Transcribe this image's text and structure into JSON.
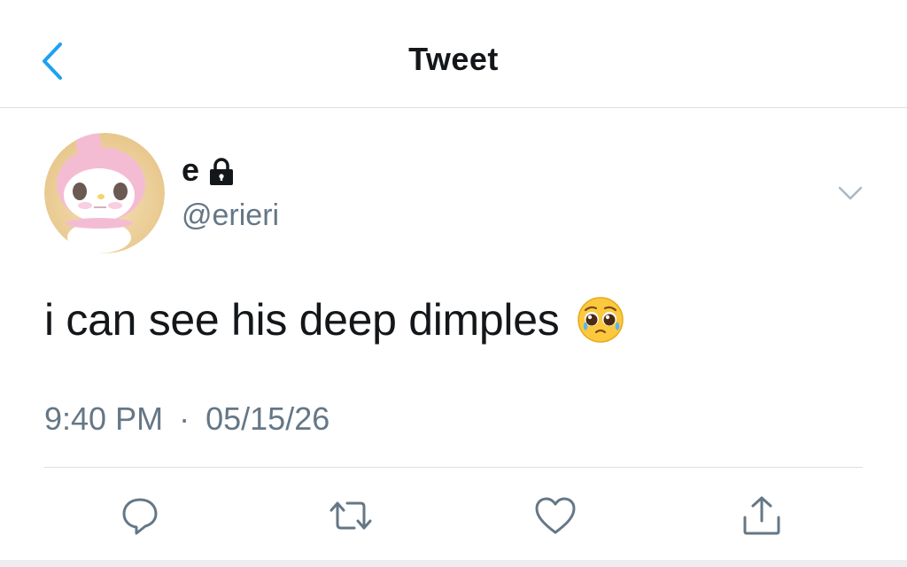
{
  "header": {
    "title": "Tweet",
    "back_icon": "chevron-left-icon"
  },
  "author": {
    "display_name": "e",
    "protected_icon": "lock-icon",
    "username": "@erieri",
    "avatar": "pink-bunny-hood-character"
  },
  "tweet": {
    "text": "i can see his deep dimples",
    "emoji": "pleading-face-with-tears",
    "time": "9:40 PM",
    "separator": "·",
    "date": "05/15/26"
  },
  "actions": [
    {
      "name": "reply",
      "icon": "speech-bubble-icon"
    },
    {
      "name": "retweet",
      "icon": "retweet-icon"
    },
    {
      "name": "like",
      "icon": "heart-icon"
    },
    {
      "name": "share",
      "icon": "share-icon"
    }
  ],
  "colors": {
    "accent": "#1da1f2",
    "text": "#14171a",
    "muted": "#657786",
    "divider": "#dcdfe3",
    "icon": "#657786"
  }
}
